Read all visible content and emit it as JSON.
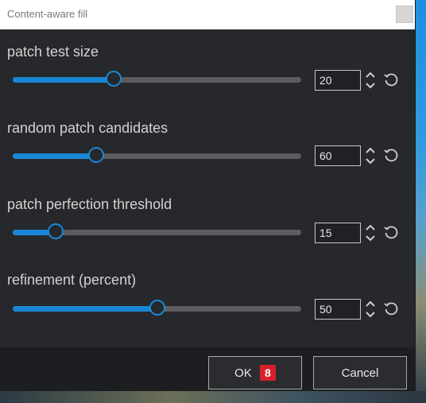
{
  "window": {
    "title": "Content-aware fill"
  },
  "sliders": [
    {
      "label": "patch test size",
      "value": "20",
      "fraction": 0.35
    },
    {
      "label": "random patch candidates",
      "value": "60",
      "fraction": 0.29
    },
    {
      "label": "patch perfection threshold",
      "value": "15",
      "fraction": 0.15
    },
    {
      "label": "refinement (percent)",
      "value": "50",
      "fraction": 0.5
    }
  ],
  "buttons": {
    "ok_label": "OK",
    "ok_badge": "8",
    "cancel_label": "Cancel"
  },
  "colors": {
    "accent": "#1a86d6",
    "background": "#26282b",
    "badge": "#d81f2b"
  },
  "icons": {
    "spin": "up-down-chevron-icon",
    "reset": "reset-icon",
    "close": "close-icon"
  }
}
